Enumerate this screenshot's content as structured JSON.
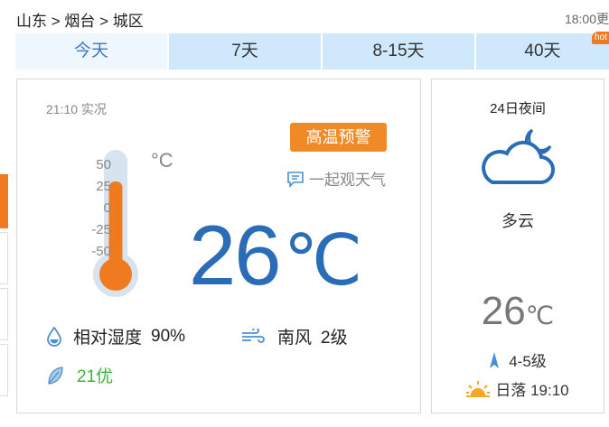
{
  "breadcrumb": "山东 > 烟台 > 城区",
  "update_time": "18:00更",
  "tabs": [
    {
      "label": "今天"
    },
    {
      "label": "7天"
    },
    {
      "label": "8-15天"
    },
    {
      "label": "40天",
      "badge": "hot"
    }
  ],
  "current": {
    "obs_time": "21:10 实况",
    "warning": "高温预警",
    "together_link": "一起观天气",
    "thermo_unit": "°C",
    "thermo_ticks": [
      "50",
      "25",
      "0",
      "-25",
      "-50"
    ],
    "temperature": "26",
    "temp_unit": "℃",
    "humidity_label": "相对湿度",
    "humidity_value": "90%",
    "wind_dir": "南风",
    "wind_level": "2级",
    "aqi": "21优"
  },
  "night": {
    "title": "24日夜间",
    "weather": "多云",
    "temperature": "26",
    "temp_unit": "℃",
    "wind": "4-5级",
    "sunset": "日落 19:10"
  },
  "colors": {
    "accent_blue": "#2a6db6",
    "warning_orange": "#f08a28",
    "thermo_fill": "#f07a1f",
    "aqi_green": "#3ab53a"
  }
}
